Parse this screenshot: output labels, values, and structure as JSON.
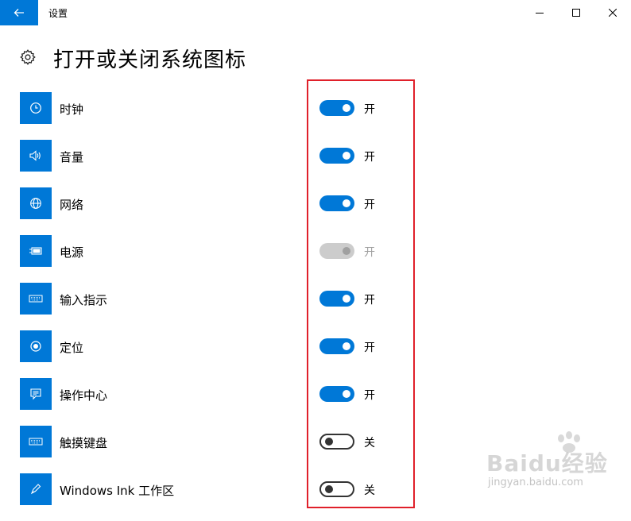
{
  "window": {
    "app_title": "设置"
  },
  "header": {
    "title": "打开或关闭系统图标"
  },
  "items": [
    {
      "label": "时钟",
      "state": "开",
      "on": true,
      "disabled": false,
      "icon": "clock-icon"
    },
    {
      "label": "音量",
      "state": "开",
      "on": true,
      "disabled": false,
      "icon": "volume-icon"
    },
    {
      "label": "网络",
      "state": "开",
      "on": true,
      "disabled": false,
      "icon": "globe-icon"
    },
    {
      "label": "电源",
      "state": "开",
      "on": true,
      "disabled": true,
      "icon": "battery-icon"
    },
    {
      "label": "输入指示",
      "state": "开",
      "on": true,
      "disabled": false,
      "icon": "keyboard-icon"
    },
    {
      "label": "定位",
      "state": "开",
      "on": true,
      "disabled": false,
      "icon": "location-icon"
    },
    {
      "label": "操作中心",
      "state": "开",
      "on": true,
      "disabled": false,
      "icon": "action-center-icon"
    },
    {
      "label": "触摸键盘",
      "state": "关",
      "on": false,
      "disabled": false,
      "icon": "keyboard-icon"
    },
    {
      "label": "Windows Ink 工作区",
      "state": "关",
      "on": false,
      "disabled": false,
      "icon": "pen-icon"
    }
  ],
  "watermark": {
    "brand": "Baidu经验",
    "url": "jingyan.baidu.com"
  },
  "colors": {
    "accent": "#0078d7",
    "highlight": "#e0202a",
    "disabled": "#cccccc"
  }
}
